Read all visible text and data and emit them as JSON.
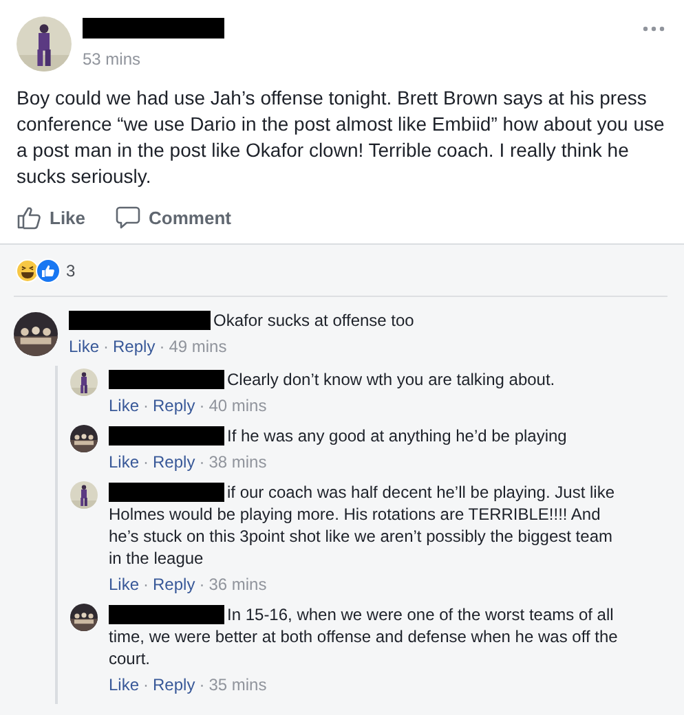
{
  "post": {
    "author_redacted": true,
    "time": "53 mins",
    "text": "Boy could we had use Jah’s offense tonight. Brett Brown says at his press conference “we use Dario in the post almost like Embiid” how about you use a post man in the post like Okafor clown! Terrible coach. I really think he sucks seriously.",
    "actions": [
      {
        "kind": "like",
        "label": "Like"
      },
      {
        "kind": "comment",
        "label": "Comment"
      }
    ],
    "reactions": {
      "count": "3"
    }
  },
  "comments": [
    {
      "author_redacted": true,
      "text": "Okafor sucks at offense too",
      "footer": [
        {
          "kind": "link",
          "text": "Like"
        },
        {
          "kind": "sep",
          "text": "·"
        },
        {
          "kind": "link",
          "text": "Reply"
        },
        {
          "kind": "sep",
          "text": "·"
        },
        {
          "kind": "time",
          "text": "49 mins"
        }
      ],
      "replies": [
        {
          "author_redacted": true,
          "text": "Clearly don’t know wth you are talking about.",
          "footer": [
            {
              "kind": "link",
              "text": "Like"
            },
            {
              "kind": "sep",
              "text": "·"
            },
            {
              "kind": "link",
              "text": "Reply"
            },
            {
              "kind": "sep",
              "text": "·"
            },
            {
              "kind": "time",
              "text": "40 mins"
            }
          ]
        },
        {
          "author_redacted": true,
          "text": "If he was any good at anything he’d be playing",
          "footer": [
            {
              "kind": "link",
              "text": "Like"
            },
            {
              "kind": "sep",
              "text": "·"
            },
            {
              "kind": "link",
              "text": "Reply"
            },
            {
              "kind": "sep",
              "text": "·"
            },
            {
              "kind": "time",
              "text": "38 mins"
            }
          ]
        },
        {
          "author_redacted": true,
          "text": "if our coach was half decent he’ll be playing. Just like Holmes would be playing more. His rotations are TERRIBLE!!!! And he’s stuck on this 3point shot like we aren’t possibly the biggest team in the league",
          "footer": [
            {
              "kind": "link",
              "text": "Like"
            },
            {
              "kind": "sep",
              "text": "·"
            },
            {
              "kind": "link",
              "text": "Reply"
            },
            {
              "kind": "sep",
              "text": "·"
            },
            {
              "kind": "time",
              "text": "36 mins"
            }
          ]
        },
        {
          "author_redacted": true,
          "text": "In 15-16, when we were one of the worst teams of all time, we were better at both offense and defense when he was off the court.",
          "footer": [
            {
              "kind": "link",
              "text": "Like"
            },
            {
              "kind": "sep",
              "text": "·"
            },
            {
              "kind": "link",
              "text": "Reply"
            },
            {
              "kind": "sep",
              "text": "·"
            },
            {
              "kind": "time",
              "text": "35 mins"
            }
          ]
        }
      ]
    }
  ]
}
